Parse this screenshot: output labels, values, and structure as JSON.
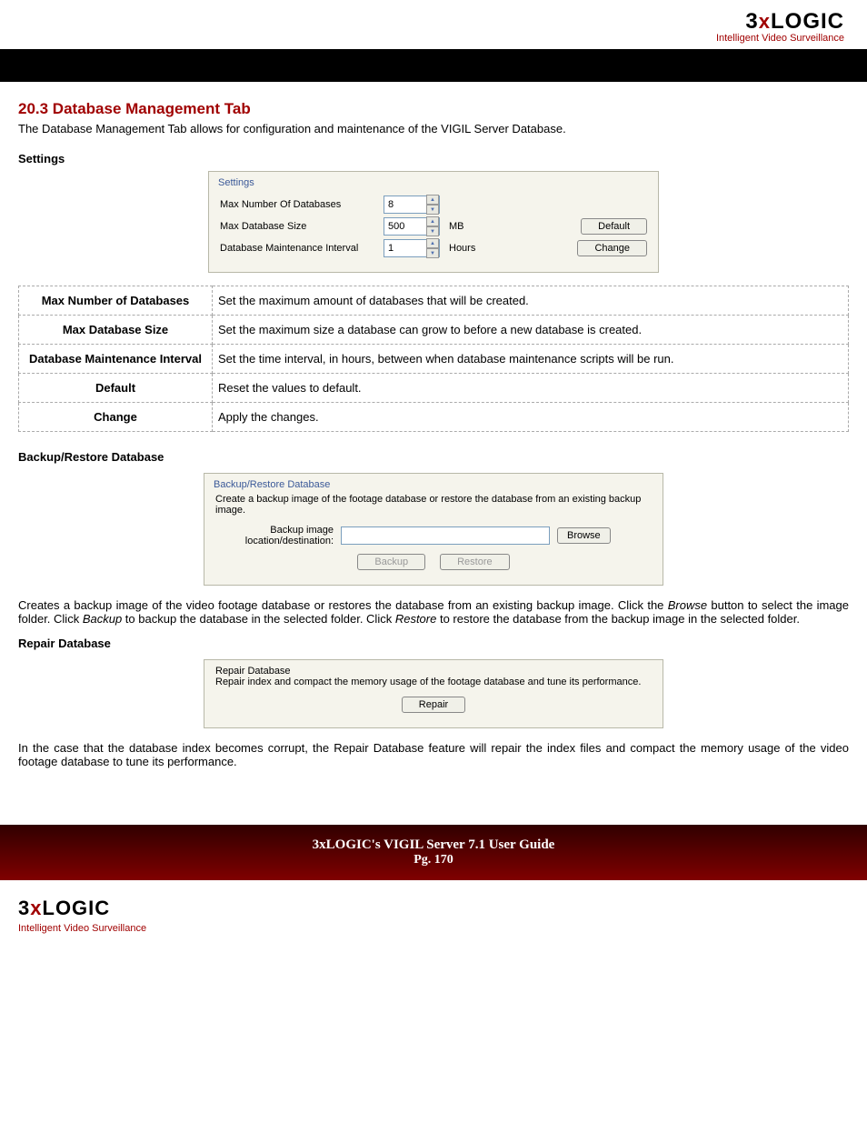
{
  "logo": {
    "prefix": "3",
    "x": "x",
    "suffix": "LOGIC",
    "tagline": "Intelligent Video Surveillance"
  },
  "section": {
    "title": "20.3 Database Management Tab",
    "intro": "The Database Management Tab allows for configuration and maintenance of the VIGIL Server Database."
  },
  "settings": {
    "heading": "Settings",
    "legend": "Settings",
    "rows": {
      "max_db": {
        "label": "Max Number Of Databases",
        "value": "8"
      },
      "max_size": {
        "label": "Max Database Size",
        "value": "500",
        "unit": "MB"
      },
      "interval": {
        "label": "Database Maintenance Interval",
        "value": "1",
        "unit": "Hours"
      }
    },
    "buttons": {
      "default": "Default",
      "change": "Change"
    }
  },
  "settings_table": [
    {
      "label": "Max Number of Databases",
      "desc": "Set the maximum amount of databases that will be created."
    },
    {
      "label": "Max Database Size",
      "desc": "Set the maximum size a database can grow to before a new database is created."
    },
    {
      "label": "Database Maintenance Interval",
      "desc": "Set the time interval, in hours, between when database maintenance scripts will be run."
    },
    {
      "label": "Default",
      "desc": "Reset the values to default."
    },
    {
      "label": "Change",
      "desc": "Apply the changes."
    }
  ],
  "backup": {
    "heading": "Backup/Restore Database",
    "legend": "Backup/Restore Database",
    "desc": "Create a backup image of the footage database or restore the database from an existing backup image.",
    "path_label": "Backup image location/destination:",
    "browse": "Browse",
    "backup_btn": "Backup",
    "restore_btn": "Restore",
    "para_pre": "Creates a backup image of the video footage database or restores the database from an existing backup image. Click the ",
    "browse_em": "Browse",
    "para_mid1": " button to select the image folder. Click ",
    "backup_em": "Backup",
    "para_mid2": " to backup the database in the selected folder. Click ",
    "restore_em": "Restore",
    "para_post": " to restore the database from the backup image in the selected folder."
  },
  "repair": {
    "heading": "Repair Database",
    "legend": "Repair Database",
    "desc": "Repair index and compact the memory usage of the footage database and tune its performance.",
    "button": "Repair",
    "para": "In the case that the database index becomes corrupt, the Repair Database feature will repair the index files and compact the memory usage of the video footage database to tune its performance."
  },
  "footer": {
    "title": "3xLOGIC's VIGIL Server 7.1 User Guide",
    "page": "Pg. 170"
  }
}
